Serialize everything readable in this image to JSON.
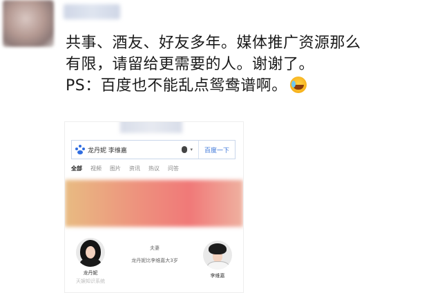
{
  "post": {
    "lines": [
      "共事、酒友、好友多年。媒体推广资源那么",
      "有限，请留给更需要的人。谢谢了。",
      "PS：百度也不能乱点鸳鸯谱啊。"
    ],
    "emoji": "laughing-crying-emoji"
  },
  "screenshot": {
    "search_query": "龙丹妮 李维嘉",
    "search_button": "百度一下",
    "tabs": [
      "全部",
      "视频",
      "图片",
      "资讯",
      "热议",
      "问答"
    ],
    "active_tab": "全部",
    "relation": {
      "label": "夫妻",
      "detail": "龙丹妮比李维嘉大3岁"
    },
    "people": [
      {
        "name": "龙丹妮",
        "subtitle": "天娱知识系统"
      },
      {
        "name": "李维嘉",
        "subtitle": ""
      }
    ]
  },
  "colors": {
    "search_blue": "#2f6de1",
    "banner_start": "#e8bb82",
    "banner_end": "#f07978"
  }
}
